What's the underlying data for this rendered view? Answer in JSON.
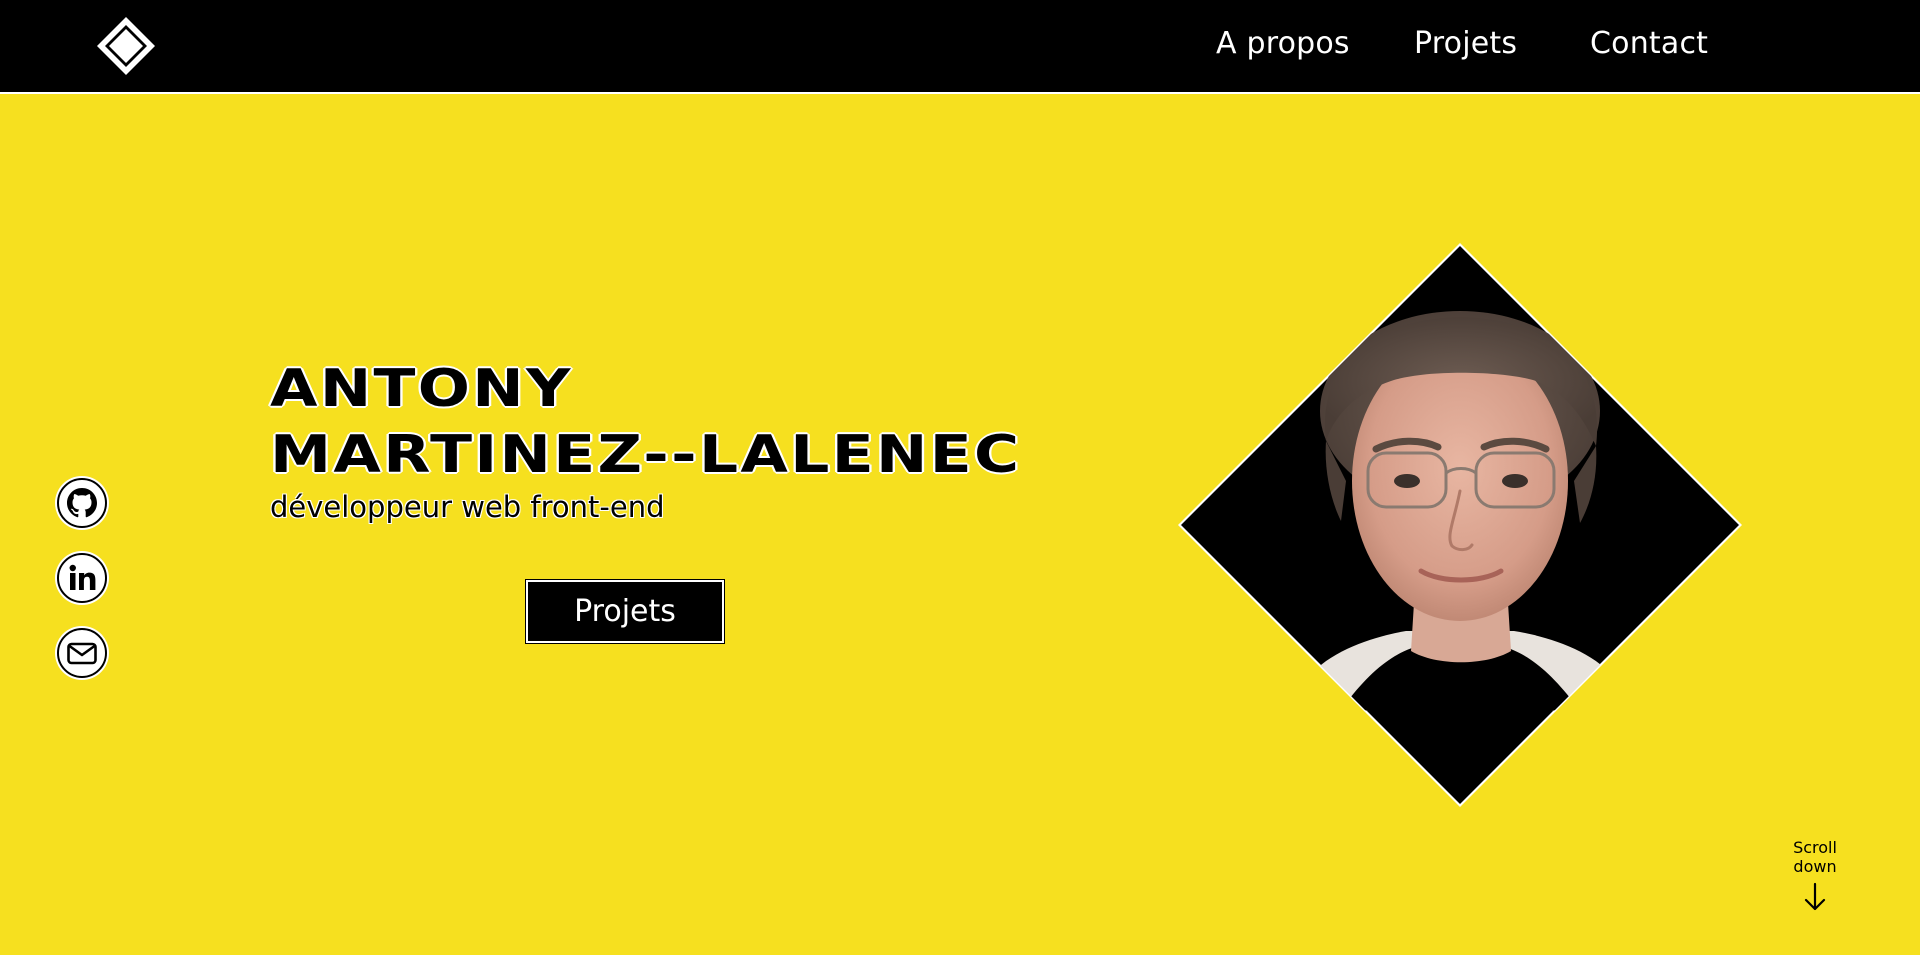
{
  "header": {
    "logo_icon": "diamond-logo-icon",
    "nav": [
      {
        "label": "A propos"
      },
      {
        "label": "Projets"
      },
      {
        "label": "Contact"
      }
    ]
  },
  "social": [
    {
      "icon": "github-icon"
    },
    {
      "icon": "linkedin-icon"
    },
    {
      "icon": "mail-icon"
    }
  ],
  "hero": {
    "name_line1": "ANTONY",
    "name_line2": "MARTINEZ--LALENEC",
    "subtitle": "développeur web front-end",
    "button_label": "Projets"
  },
  "scroll": {
    "label_line1": "Scroll",
    "label_line2": "down"
  },
  "colors": {
    "background": "#f6e01f",
    "header": "#000000",
    "accent_text": "#000000"
  }
}
